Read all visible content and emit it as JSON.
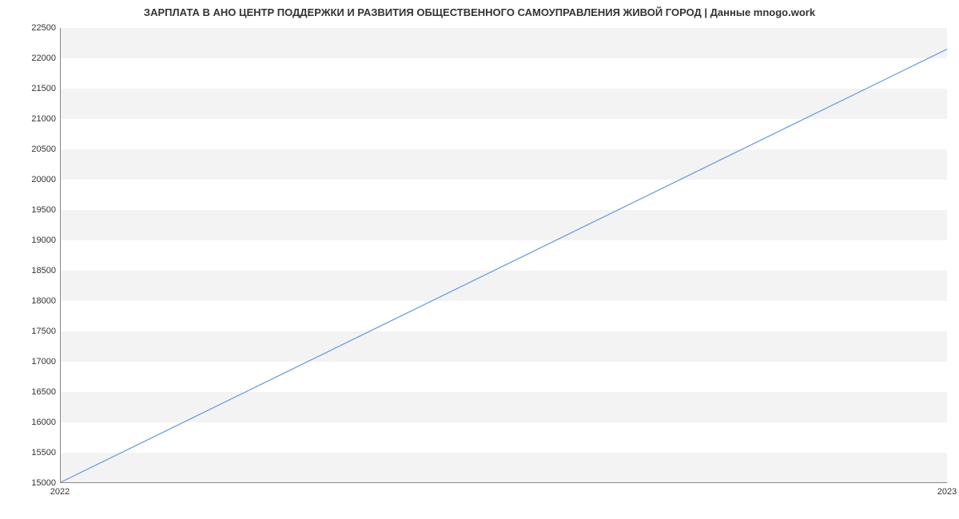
{
  "chart_data": {
    "type": "line",
    "title": "ЗАРПЛАТА В АНО ЦЕНТР ПОДДЕРЖКИ И РАЗВИТИЯ ОБЩЕСТВЕННОГО САМОУПРАВЛЕНИЯ ЖИВОЙ ГОРОД | Данные mnogo.work",
    "x": [
      2022,
      2023
    ],
    "values": [
      15000,
      22150
    ],
    "xlabel": "",
    "ylabel": "",
    "x_ticks": [
      2022,
      2023
    ],
    "y_ticks": [
      15000,
      15500,
      16000,
      16500,
      17000,
      17500,
      18000,
      18500,
      19000,
      19500,
      20000,
      20500,
      21000,
      21500,
      22000,
      22500
    ],
    "xlim": [
      2022,
      2023
    ],
    "ylim": [
      15000,
      22500
    ]
  }
}
